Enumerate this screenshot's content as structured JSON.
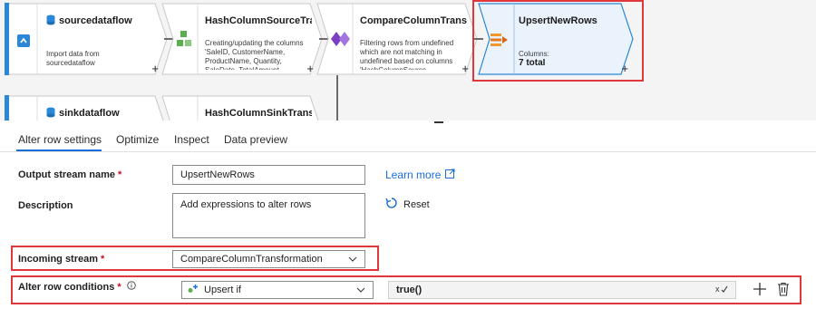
{
  "canvas": {
    "nodes": [
      {
        "title": "sourcedataflow",
        "description": "Import data from sourcedataflow",
        "icon": "source-icon"
      },
      {
        "title": "HashColumnSourceTran...",
        "description": "Creating/updating the columns 'SaleID, CustomerName, ProductName, Quantity, SaleDate, TotalAmount, HashColumnSource'",
        "icon": "derived-column-icon"
      },
      {
        "title": "CompareColumnTransf...",
        "description": "Filtering rows from undefined which are not matching in undefined based on columns 'HashColumnSource, HashColumnSink'",
        "icon": "exists-icon"
      },
      {
        "title": "UpsertNewRows",
        "columns_label": "Columns:",
        "columns_value": "7 total",
        "icon": "alter-row-icon"
      },
      {
        "title": "sinkdataflow",
        "icon": "sink-icon"
      },
      {
        "title": "HashColumnSinkTransf...",
        "icon": "derived-column-icon"
      }
    ],
    "add_symbol": "+"
  },
  "tabs": [
    "Alter row settings",
    "Optimize",
    "Inspect",
    "Data preview"
  ],
  "form": {
    "output_stream_label": "Output stream name",
    "output_stream_value": "UpsertNewRows",
    "learn_more": "Learn more",
    "description_label": "Description",
    "description_value": "Add expressions to alter rows",
    "reset": "Reset",
    "incoming_stream_label": "Incoming stream",
    "incoming_stream_value": "CompareColumnTransformation",
    "conditions_label": "Alter row conditions",
    "condition_type": "Upsert if",
    "condition_expression": "true()",
    "required_mark": "*"
  },
  "colors": {
    "accent": "#1a6ed8",
    "highlight": "#e0363c",
    "node_selected": "#eaf3fc",
    "node_bar": "#2b88d8"
  }
}
